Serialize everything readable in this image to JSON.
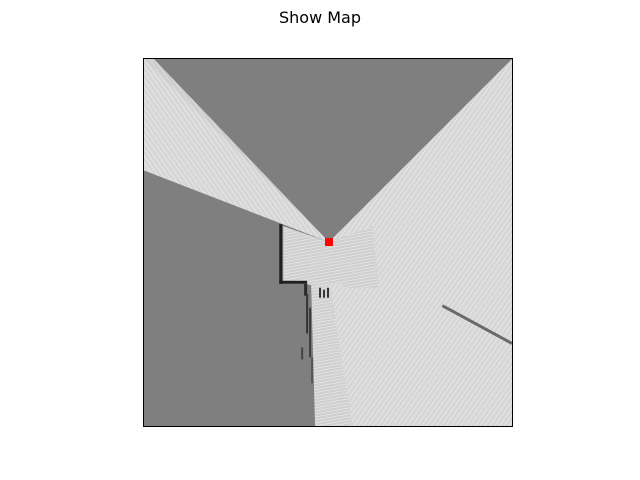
{
  "figure": {
    "title": "Show Map"
  },
  "map": {
    "unknown_color": "#7f7f7f",
    "free_color": "#d9d9d9",
    "occupied_color": "#1f1f1f",
    "robot_color": "#ff0000",
    "frame_color": "#000000"
  }
}
